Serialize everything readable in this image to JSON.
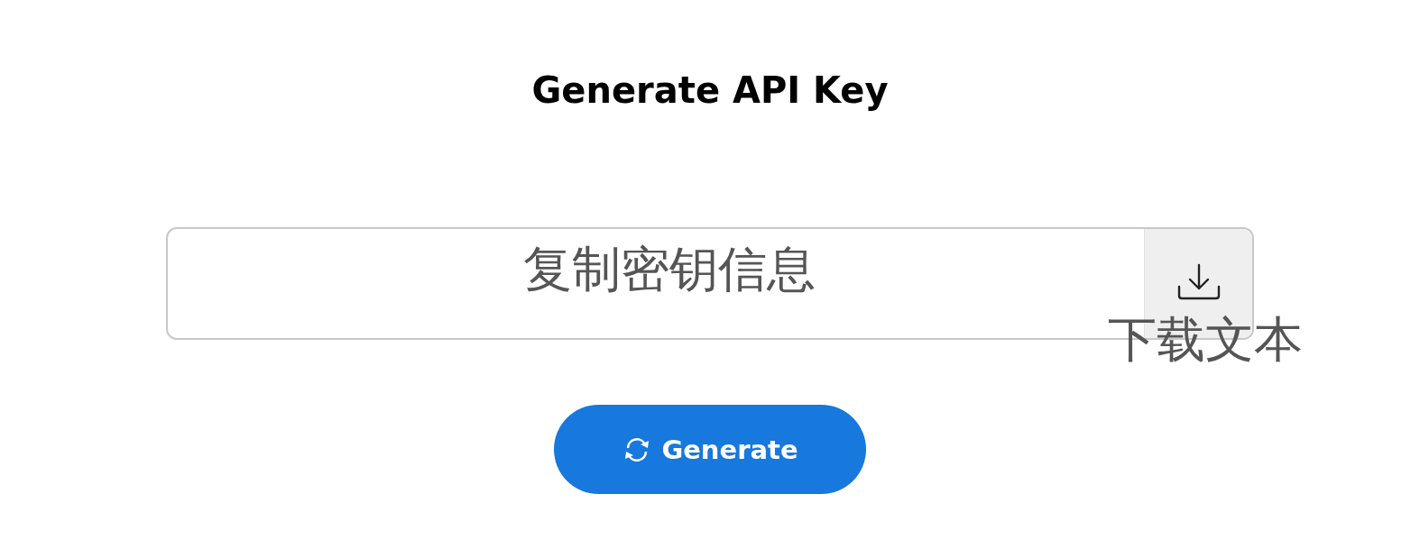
{
  "title": "Generate API Key",
  "key_field": {
    "overlay_label": "复制密钥信息"
  },
  "download": {
    "label": "下载文本"
  },
  "generate_button": {
    "label": "Generate"
  }
}
